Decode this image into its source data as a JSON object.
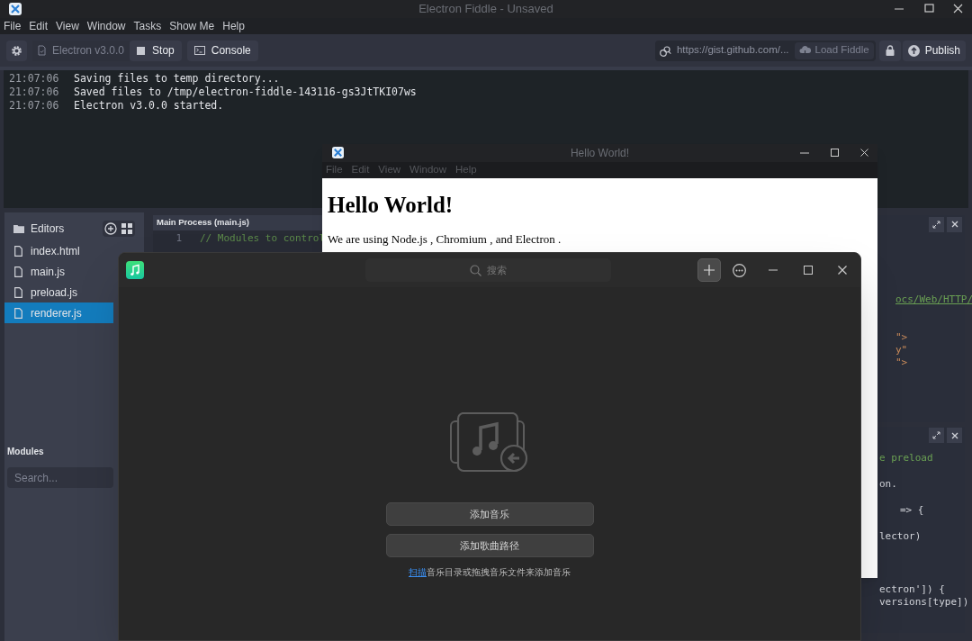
{
  "main_window": {
    "title": "Electron Fiddle - Unsaved",
    "menu": [
      "File",
      "Edit",
      "View",
      "Window",
      "Tasks",
      "Show Me",
      "Help"
    ],
    "toolbar": {
      "version": "Electron v3.0.0",
      "stop": "Stop",
      "console": "Console",
      "gist_placeholder": "https://gist.github.com/...",
      "load": "Load Fiddle",
      "publish": "Publish"
    },
    "console": [
      {
        "time": "21:07:06",
        "message": "Saving files to temp directory..."
      },
      {
        "time": "21:07:06",
        "message": "Saved files to /tmp/electron-fiddle-143116-gs3JtTKI07ws"
      },
      {
        "time": "21:07:06",
        "message": "Electron v3.0.0 started."
      }
    ],
    "sidebar": {
      "heading": "Editors",
      "files": [
        {
          "name": "index.html",
          "selected": false
        },
        {
          "name": "main.js",
          "selected": false
        },
        {
          "name": "preload.js",
          "selected": false
        },
        {
          "name": "renderer.js",
          "selected": true
        }
      ],
      "modules_heading": "Modules",
      "search_placeholder": "Search..."
    },
    "main_editor": {
      "title": "Main Process (main.js)",
      "lines": [
        {
          "number": "1",
          "code": "// Modules to control"
        }
      ]
    },
    "side_editors": [
      {
        "fragments": [
          {
            "text": "ocs/Web/HTTP/",
            "kind": "link"
          },
          {
            "text": "\">",
            "kind": "string"
          },
          {
            "text": "y\"",
            "kind": "string"
          },
          {
            "text": "\">",
            "kind": "string"
          }
        ]
      },
      {
        "fragments": [
          {
            "text": "e preload",
            "kind": "comment"
          },
          {
            "text": "on.",
            "kind": "plain"
          },
          {
            "text": "=> {",
            "kind": "plain"
          },
          {
            "text": "lector)",
            "kind": "plain"
          },
          {
            "text": "ectron']) {",
            "kind": "plain"
          },
          {
            "text": "versions[type])",
            "kind": "plain"
          }
        ]
      }
    ]
  },
  "hello_window": {
    "title": "Hello World!",
    "menu": [
      "File",
      "Edit",
      "View",
      "Window",
      "Help"
    ],
    "heading": "Hello World!",
    "text": "We are using Node.js , Chromium , and Electron ."
  },
  "music_window": {
    "search_placeholder": "搜索",
    "buttons": [
      "添加音乐",
      "添加歌曲路径"
    ],
    "hint_link": "扫描",
    "hint": "音乐目录或拖拽音乐文件来添加音乐"
  }
}
